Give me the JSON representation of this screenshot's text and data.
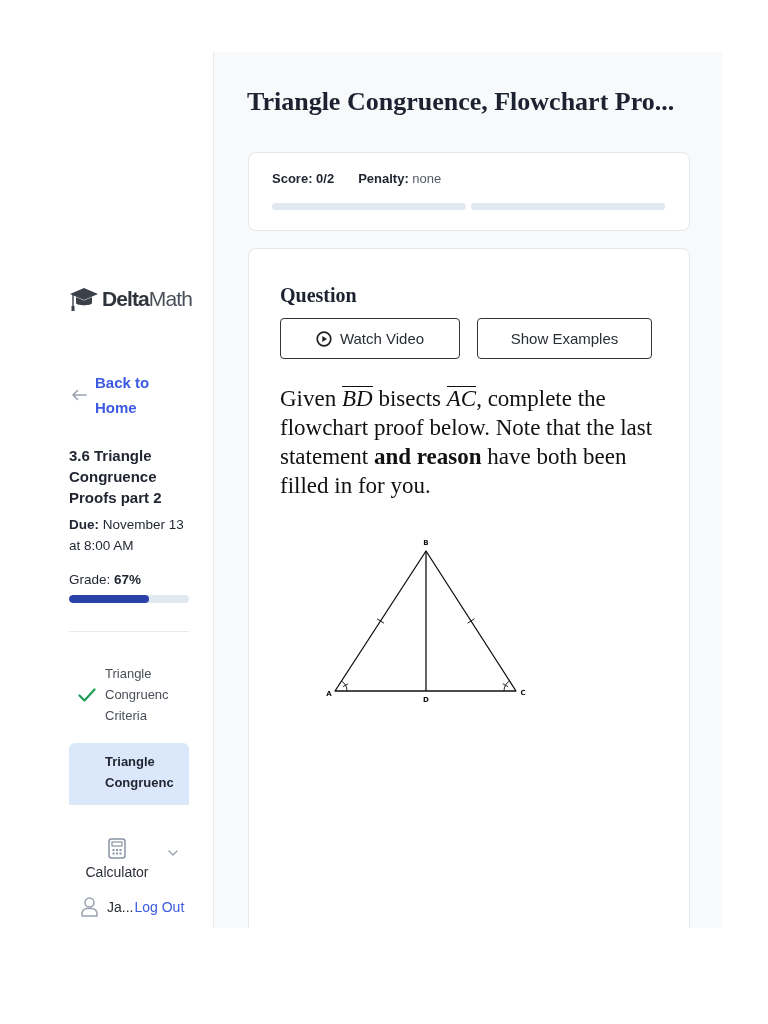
{
  "sidebar": {
    "logo": "**Delta**Math",
    "back_link": "Back to Home",
    "assignment": {
      "title": "3.6 Triangle Congruence Proofs part 2",
      "due": "**Due:** November 13 at 8:00 AM",
      "grade": "Grade: **67%**",
      "level": 0.67
    },
    "items": [
      {
        "label": "Triangle Congruenc Criteria",
        "complete": true,
        "selected": false
      },
      {
        "label": "Triangle Congruenc",
        "complete": false,
        "selected": true
      }
    ],
    "calculator": {
      "label": "Calculator"
    },
    "user": {
      "name": "Ja...",
      "logout": "Log Out"
    }
  },
  "main": {
    "title": "Triangle Congruence, Flowchart Pro...",
    "score": "Score: 0/2",
    "penalty": "**Penalty:** none",
    "parts": [
      {
        "done": false
      },
      {
        "done": false
      }
    ],
    "question": {
      "heading": "Question",
      "buttons": [
        {
          "kind": "video",
          "label": "Watch Video"
        },
        {
          "kind": "plain",
          "label": "Show Examples"
        }
      ],
      "problem": [
        {
          "kind": "text",
          "text": "Given "
        },
        {
          "kind": "segment",
          "text": "BD"
        },
        {
          "kind": "text",
          "text": " bisects "
        },
        {
          "kind": "segment",
          "text": "AC"
        },
        {
          "kind": "text",
          "text": ", complete the flowchart proof below. Note that the last statement "
        },
        {
          "kind": "bold",
          "text": "and reason"
        },
        {
          "kind": "text",
          "text": " have both been filled in for you."
        }
      ],
      "diagram": {
        "vertex_labels": [
          "A",
          "B",
          "C",
          "D"
        ]
      }
    }
  }
}
